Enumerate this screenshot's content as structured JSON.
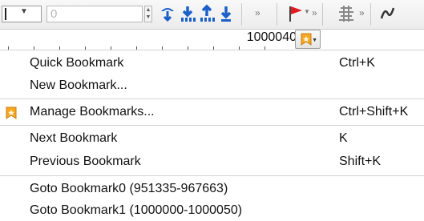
{
  "toolbar": {
    "spin_value": "0",
    "position_value": "1000040",
    "overflow_chevron": "»"
  },
  "colors": {
    "arrow_blue": "#1c5fc9",
    "flag_red": "#e01b24",
    "bookmark_orange": "#f5a623"
  },
  "menu": {
    "items": [
      {
        "label": "Quick Bookmark",
        "shortcut": "Ctrl+K"
      },
      {
        "label": "New Bookmark...",
        "shortcut": ""
      },
      {
        "label": "Manage Bookmarks...",
        "shortcut": "Ctrl+Shift+K",
        "icon": "bookmark-icon"
      },
      {
        "label": "Next Bookmark",
        "shortcut": "K"
      },
      {
        "label": "Previous Bookmark",
        "shortcut": "Shift+K"
      },
      {
        "label": "Goto Bookmark0 (951335-967663)",
        "shortcut": ""
      },
      {
        "label": "Goto Bookmark1 (1000000-1000050)",
        "shortcut": ""
      }
    ]
  }
}
